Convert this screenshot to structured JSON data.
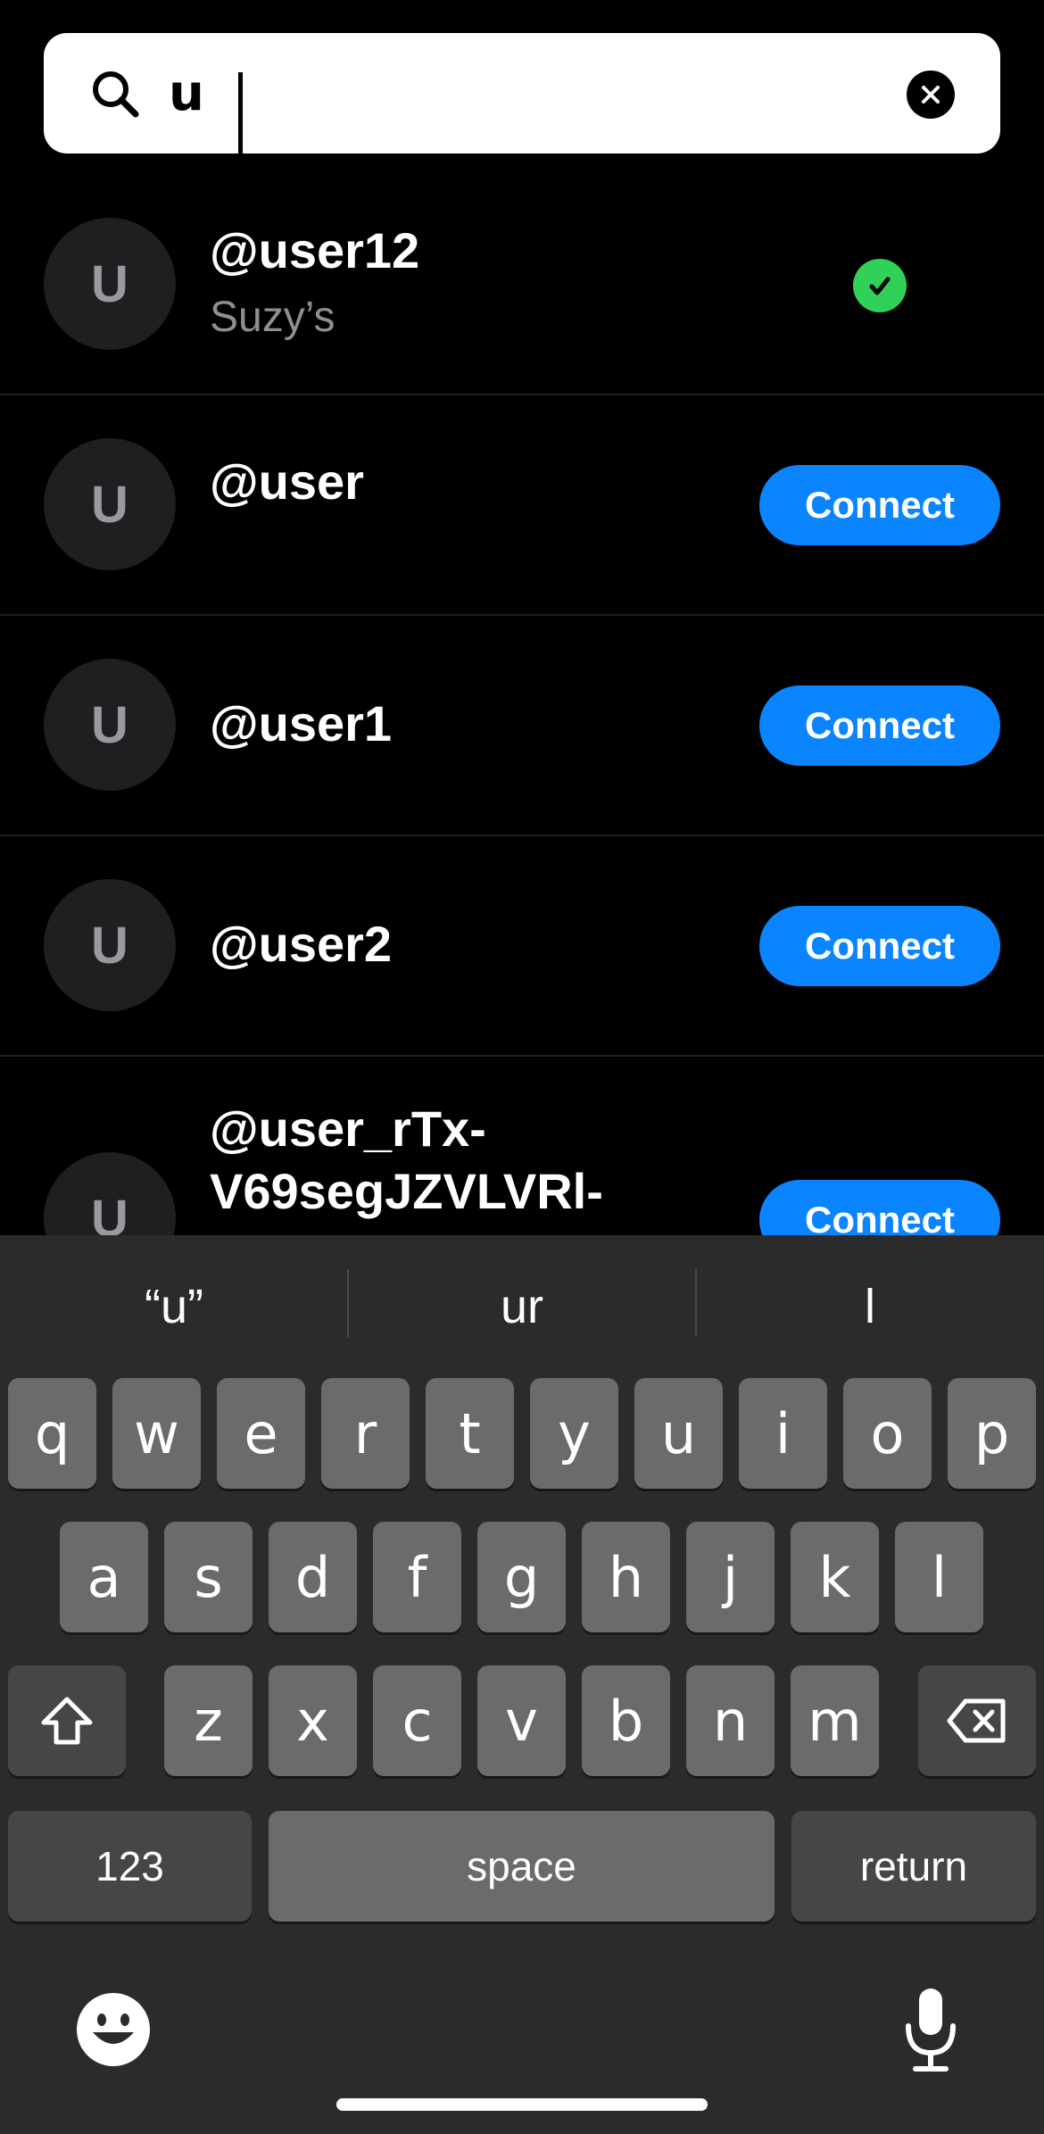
{
  "search": {
    "query": "u",
    "icon": "search-icon",
    "clear_icon": "clear-icon"
  },
  "results": [
    {
      "avatar_letter": "U",
      "username": "@user12",
      "subtitle": "Suzy’s",
      "status": "connected"
    },
    {
      "avatar_letter": "U",
      "username": "@user",
      "action": "Connect"
    },
    {
      "avatar_letter": "U",
      "username": "@user1",
      "action": "Connect"
    },
    {
      "avatar_letter": "U",
      "username": "@user2",
      "action": "Connect"
    },
    {
      "avatar_letter": "U",
      "username_line1": "@user_rTx-",
      "username_line2": "V69segJZVLVRl-",
      "action": "Connect"
    }
  ],
  "keyboard": {
    "suggestions": [
      "“u”",
      "ur",
      "l"
    ],
    "row1": [
      "q",
      "w",
      "e",
      "r",
      "t",
      "y",
      "u",
      "i",
      "o",
      "p"
    ],
    "row2": [
      "a",
      "s",
      "d",
      "f",
      "g",
      "h",
      "j",
      "k",
      "l"
    ],
    "row3": [
      "z",
      "x",
      "c",
      "v",
      "b",
      "n",
      "m"
    ],
    "numbers_label": "123",
    "space_label": "space",
    "return_label": "return",
    "icons": [
      "shift-icon",
      "backspace-icon",
      "emoji-icon",
      "microphone-icon"
    ]
  },
  "colors": {
    "accent": "#0a84ff",
    "connected": "#30d158",
    "background": "#000000",
    "keyboard": "#2b2b2b"
  }
}
